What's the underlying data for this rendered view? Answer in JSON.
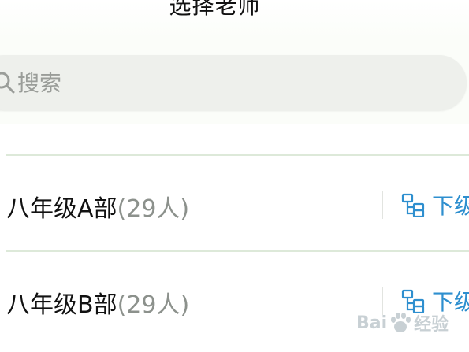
{
  "header": {
    "title": "选择老师"
  },
  "search": {
    "placeholder": "搜索",
    "icon": "search-icon"
  },
  "list": {
    "items": [
      {
        "name": "八年级A部",
        "count": "(29人)",
        "action_label": "下级",
        "action_icon": "hierarchy-icon"
      },
      {
        "name": "八年级B部",
        "count": "(29人)",
        "action_label": "下级",
        "action_icon": "hierarchy-icon"
      }
    ]
  },
  "watermark": {
    "text_left": "Bai",
    "text_right": "经验"
  },
  "colors": {
    "accent": "#2e8fcf",
    "divider": "#dde9d9",
    "search_bg": "#eef0ec",
    "muted_text": "#8c918c"
  }
}
